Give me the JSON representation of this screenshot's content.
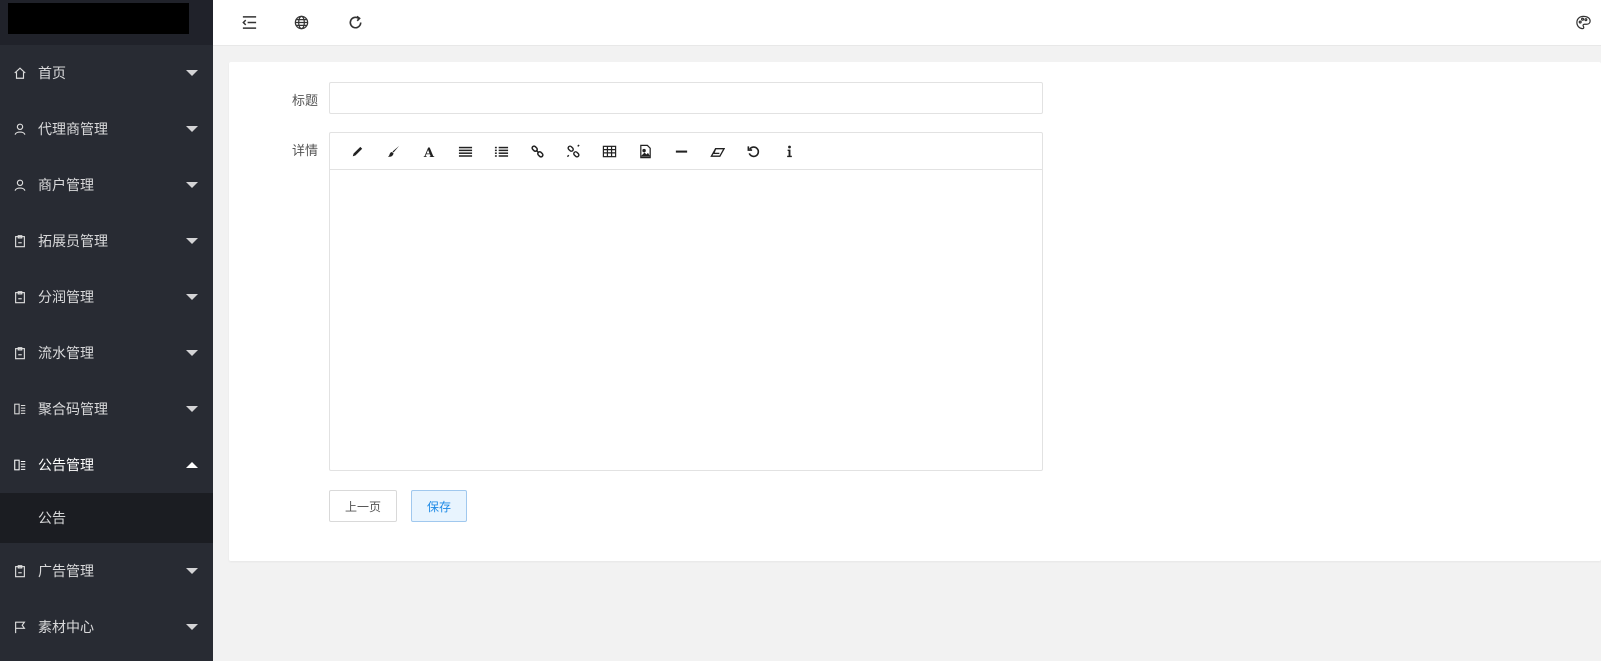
{
  "sidebar": {
    "items": [
      {
        "label": "首页",
        "icon": "home-icon",
        "expanded": false
      },
      {
        "label": "代理商管理",
        "icon": "user-icon",
        "expanded": false
      },
      {
        "label": "商户管理",
        "icon": "user-icon",
        "expanded": false
      },
      {
        "label": "拓展员管理",
        "icon": "clipboard-icon",
        "expanded": false
      },
      {
        "label": "分润管理",
        "icon": "clipboard-icon",
        "expanded": false
      },
      {
        "label": "流水管理",
        "icon": "clipboard-icon",
        "expanded": false
      },
      {
        "label": "聚合码管理",
        "icon": "read-icon",
        "expanded": false
      },
      {
        "label": "公告管理",
        "icon": "read-icon",
        "expanded": true
      },
      {
        "label": "广告管理",
        "icon": "clipboard-icon",
        "expanded": false
      },
      {
        "label": "素材中心",
        "icon": "flag-icon",
        "expanded": false
      }
    ],
    "sub_items": [
      {
        "label": "公告"
      }
    ]
  },
  "header": {
    "tools": [
      "shrink-menu-icon",
      "website-icon",
      "refresh-icon",
      "theme-icon"
    ]
  },
  "form": {
    "title_label": "标题",
    "title_value": "",
    "detail_label": "详情",
    "editor_tools": [
      "pencil-icon",
      "brush-icon",
      "font-icon",
      "align-icon",
      "list-icon",
      "link-icon",
      "unlink-icon",
      "table-icon",
      "image-icon",
      "hr-icon",
      "eraser-icon",
      "undo-icon",
      "info-icon"
    ],
    "prev_button": "上一页",
    "save_button": "保存"
  },
  "colors": {
    "sidebar_bg": "#282b33",
    "submenu_bg": "#1b1d22",
    "accent": "#1e8ae6"
  }
}
